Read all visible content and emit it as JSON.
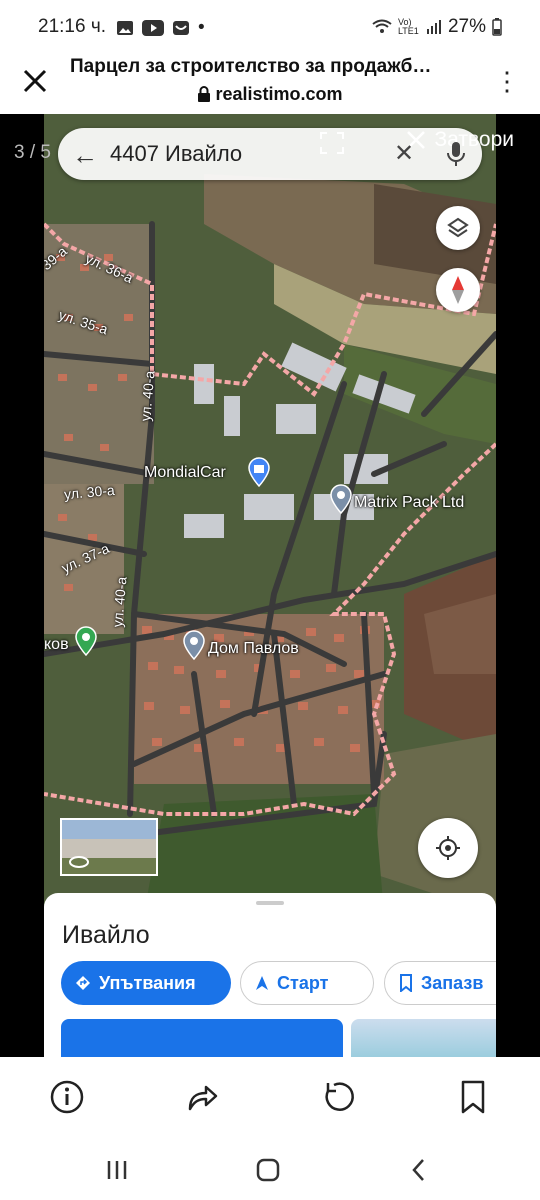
{
  "status_bar": {
    "time": "21:16 ч.",
    "network": "Vo) LTE1",
    "battery": "27%"
  },
  "browser": {
    "title": "Парцел за строителство за продажб…",
    "url": "realistimo.com"
  },
  "gallery": {
    "counter": "3 / 5",
    "close_label": "Затвори"
  },
  "map": {
    "search_query": "4407 Ивайло",
    "labels": {
      "mondialcar": "MondialCar",
      "matrix_pack": "Matrix Pack Ltd",
      "dom_pavlov": "Дом Павлов",
      "kov": "ков"
    },
    "streets": {
      "s36a": "ул. 36-а",
      "s35a": "ул. 35-а",
      "s40a_top": "ул. 40-а",
      "s30a": "ул. 30-а",
      "s37a": "ул. 37-а",
      "s40a_bottom": "ул. 40-а",
      "s39a": "39-а"
    }
  },
  "sheet": {
    "place_name": "Ивайло",
    "directions_label": "Упътвания",
    "start_label": "Старт",
    "save_label": "Запазв"
  },
  "colors": {
    "accent": "#1a73e8",
    "boundary": "#f4a7a7"
  }
}
